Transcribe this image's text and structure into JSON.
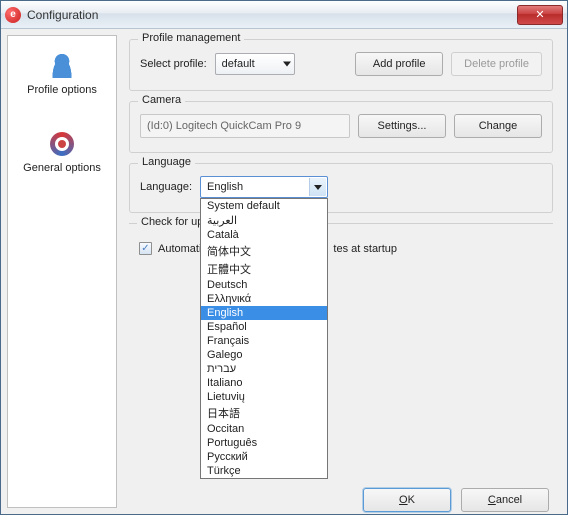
{
  "window": {
    "title": "Configuration",
    "close_icon": "✕"
  },
  "sidebar": {
    "items": [
      {
        "label": "Profile options"
      },
      {
        "label": "General options"
      }
    ]
  },
  "profile": {
    "group_title": "Profile management",
    "select_label": "Select profile:",
    "selected": "default",
    "add_button": "Add profile",
    "delete_button": "Delete profile"
  },
  "camera": {
    "group_title": "Camera",
    "device": "(Id:0) Logitech QuickCam Pro 9",
    "settings_button": "Settings...",
    "change_button": "Change"
  },
  "language": {
    "group_title": "Language",
    "label": "Language:",
    "selected": "English",
    "options": [
      "System default",
      "العربية",
      "Català",
      "简体中文",
      "正體中文",
      "Deutsch",
      "Ελληνικά",
      "English",
      "Español",
      "Français",
      "Galego",
      "עברית",
      "Italiano",
      "Lietuvių",
      "日本語",
      "Occitan",
      "Português",
      "Русский",
      "Türkçe"
    ],
    "selected_index": 7
  },
  "updates": {
    "group_title": "Check for updates",
    "checkbox_label_a": "Automati",
    "checkbox_label_b": "tes at startup",
    "checked": true
  },
  "buttons": {
    "ok": "OK",
    "cancel": "Cancel"
  }
}
